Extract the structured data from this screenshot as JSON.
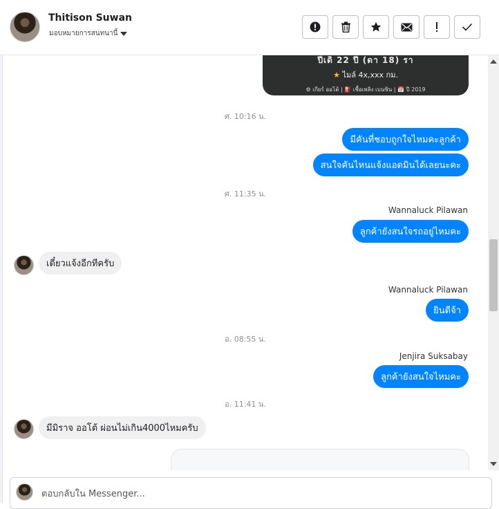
{
  "header": {
    "name": "Thitison Suwan",
    "assign_label": "มอบหมายการสนทนานี้",
    "actions": [
      {
        "icon": "alert-circle-icon",
        "label": "Mark as spam"
      },
      {
        "icon": "trash-icon",
        "label": "Delete"
      },
      {
        "icon": "star-icon",
        "label": "Star"
      },
      {
        "icon": "envelope-icon",
        "label": "Mark as unread"
      },
      {
        "icon": "exclamation-icon",
        "label": "Follow up"
      },
      {
        "icon": "check-icon",
        "label": "Mark as done"
      }
    ]
  },
  "card": {
    "title": "ปีเดิ 22 ปี (ดา 18) รา",
    "km": "ไมล์ 4x,xxx กม.",
    "specs": "⚙ เกียร์ ออโต้  |  ⛽ เชื้อเพลิง เบนซิน  |  📅 ปี 2019"
  },
  "messages": {
    "ts1": "ศ. 10:16 น.",
    "m1": "มีคันที่ชอบถูกใจไหมคะลูกค้า",
    "m2": "สนใจคันไหนแจ้งแอดมินได้เลยนะคะ",
    "ts2": "ศ. 11:35 น.",
    "sender1": "Wannaluck Pilawan",
    "m3": "ลูกค้ายังสนใจรถอยู่ไหมคะ",
    "in1": "เดี๋ยวแจ้งอีกทีครับ",
    "sender2": "Wannaluck Pilawan",
    "m4": "ยินดีจ้า",
    "ts3": "อ. 08:55 น.",
    "sender3": "Jenjira Suksabay",
    "m5": "ลูกค้ายังสนใจไหมคะ",
    "ts4": "อ. 11:41 น.",
    "in2": "มีมิราจ ออโต้ ผ่อนไม่เกิน4000ไหมครับ"
  },
  "reply": {
    "placeholder": "ตอบกลับใน Messenger..."
  }
}
